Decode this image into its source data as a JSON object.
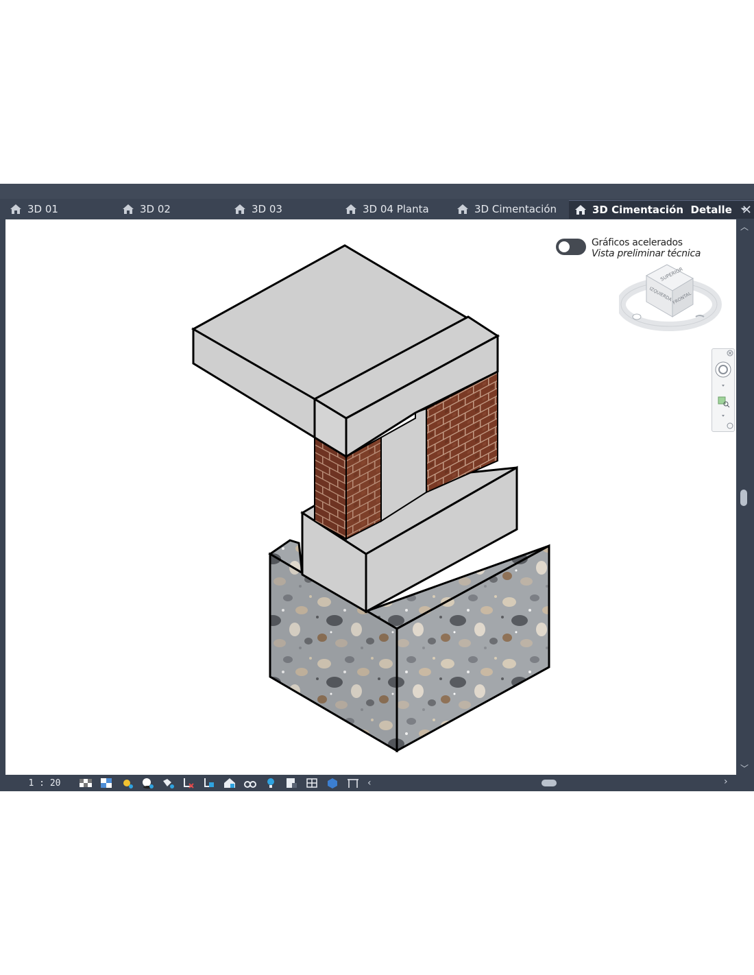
{
  "tabs": [
    {
      "label": "3D 01",
      "active": false
    },
    {
      "label": "3D 02",
      "active": false
    },
    {
      "label": "3D 03",
      "active": false
    },
    {
      "label": "3D 04 Planta",
      "active": false
    },
    {
      "label": "3D Cimentación",
      "active": false
    },
    {
      "label": "3D Cimentación  Detalle",
      "active": true
    }
  ],
  "tab_close_glyph": "✕",
  "tab_menu_glyph": "⏷",
  "overlay": {
    "line1": "Gráficos acelerados",
    "line2": "Vista preliminar técnica",
    "toggle_on": false
  },
  "viewcube": {
    "top": "SUPERIOR",
    "left": "IZQUIERDA",
    "front": "FRONTAL"
  },
  "statusbar": {
    "scale": "1 : 20"
  },
  "colors": {
    "chrome": "#3a4352",
    "concrete": "#cfcfcf",
    "brick": "#7a3b26"
  }
}
